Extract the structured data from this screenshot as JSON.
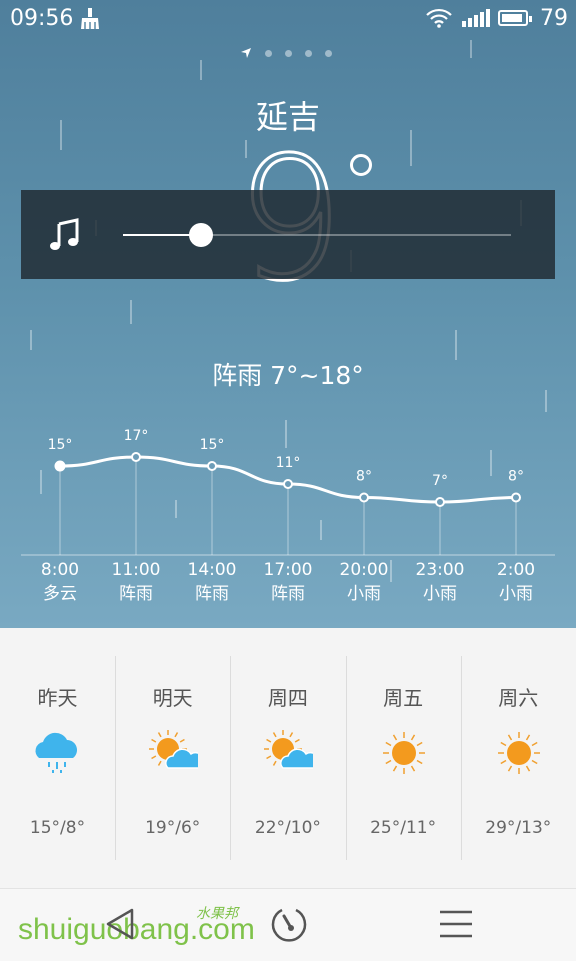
{
  "status_bar": {
    "time": "09:56",
    "battery_level": "79"
  },
  "city": "延吉",
  "current_temp": "9",
  "summary": "阵雨 7°~18°",
  "music": {
    "progress": 0.2
  },
  "hourly": [
    {
      "time": "8:00",
      "condition": "多云",
      "temp_label": "15°",
      "temp": 15
    },
    {
      "time": "11:00",
      "condition": "阵雨",
      "temp_label": "17°",
      "temp": 17
    },
    {
      "time": "14:00",
      "condition": "阵雨",
      "temp_label": "15°",
      "temp": 15
    },
    {
      "time": "17:00",
      "condition": "阵雨",
      "temp_label": "11°",
      "temp": 11
    },
    {
      "time": "20:00",
      "condition": "小雨",
      "temp_label": "8°",
      "temp": 8
    },
    {
      "time": "23:00",
      "condition": "小雨",
      "temp_label": "7°",
      "temp": 7
    },
    {
      "time": "2:00",
      "condition": "小雨",
      "temp_label": "8°",
      "temp": 8
    }
  ],
  "daily": [
    {
      "day": "昨天",
      "icon": "rain-cloud-icon",
      "temps": "15°/8°"
    },
    {
      "day": "明天",
      "icon": "partly-cloudy-icon",
      "temps": "19°/6°"
    },
    {
      "day": "周四",
      "icon": "partly-cloudy-icon",
      "temps": "22°/10°"
    },
    {
      "day": "周五",
      "icon": "sun-icon",
      "temps": "25°/11°"
    },
    {
      "day": "周六",
      "icon": "sun-icon",
      "temps": "29°/13°"
    }
  ],
  "watermark": {
    "text": "shuiguobang.com",
    "cn": "水果邦"
  },
  "colors": {
    "sun": "#f39a1e",
    "sun_ray": "#f0a030",
    "cloud_blue": "#3fb4ec",
    "watermark": "#7fc24a"
  }
}
